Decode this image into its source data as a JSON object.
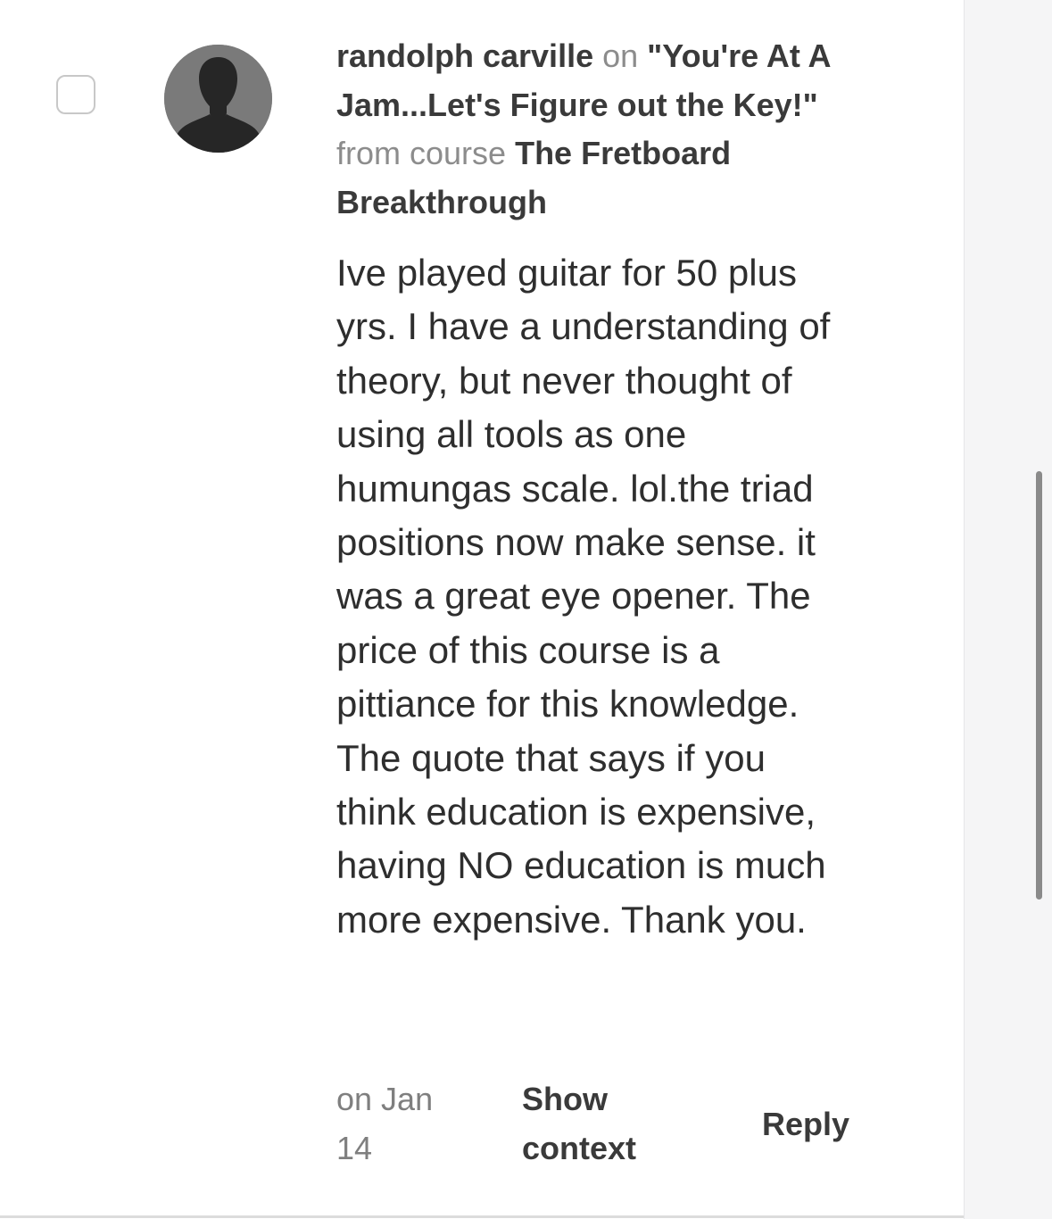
{
  "comment": {
    "author": "randolph carville",
    "on_word": "on",
    "lesson_title": "\"You're At A Jam...Let's Figure out the Key!\"",
    "from_course_text": "from course",
    "course_name": "The Fretboard Breakthrough",
    "body": "Ive played guitar for 50 plus yrs. I have a understanding of theory, but never thought of using all tools as one humungas scale. lol.the triad positions now make sense. it was a great eye opener. The price of this course is a pittiance for this knowledge. The quote that says if you think education is expensive, having NO education is much more expensive. Thank you.",
    "date": "on Jan 14",
    "show_context_label": "Show context",
    "reply_label": "Reply"
  },
  "icons": {
    "avatar": "default-user-avatar-icon",
    "checkbox": "unchecked-checkbox"
  },
  "colors": {
    "muted_text": "#8c8c8c",
    "body_text": "#2e2e2e",
    "avatar_bg": "#7a7a7a",
    "scrollbar": "#8a8a8a",
    "panel_bg": "#f5f5f6"
  }
}
